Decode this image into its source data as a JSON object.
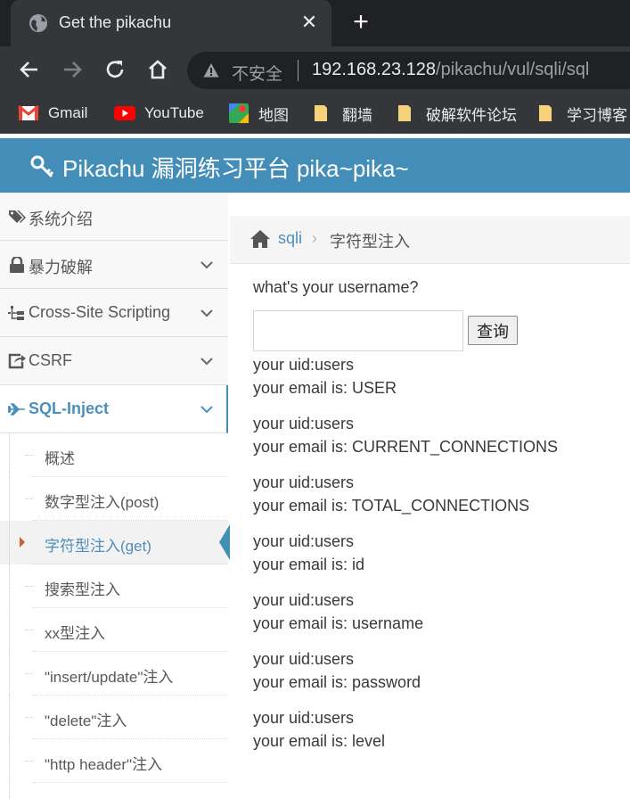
{
  "browser": {
    "tab_title": "Get the pikachu",
    "close_glyph": "✕",
    "new_tab_glyph": "+",
    "insecure_label": "不安全",
    "url_host": "192.168.23.128",
    "url_path": "/pikachu/vul/sqli/sql"
  },
  "bookmarks": [
    {
      "label": "Gmail",
      "icon": "gmail-icon"
    },
    {
      "label": "YouTube",
      "icon": "youtube-icon"
    },
    {
      "label": "地图",
      "icon": "maps-icon"
    },
    {
      "label": "翻墙",
      "icon": "folder-icon"
    },
    {
      "label": "破解软件论坛",
      "icon": "folder-icon"
    },
    {
      "label": "学习博客",
      "icon": "folder-icon"
    }
  ],
  "header": {
    "title": "Pikachu 漏洞练习平台 pika~pika~"
  },
  "sidebar": {
    "items": [
      {
        "label": "系统介绍",
        "icon": "tags-icon"
      },
      {
        "label": "暴力破解",
        "icon": "lock-icon"
      },
      {
        "label": "Cross-Site Scripting",
        "icon": "sitemap-icon"
      },
      {
        "label": "CSRF",
        "icon": "share-icon"
      },
      {
        "label": "SQL-Inject",
        "icon": "plane-icon"
      }
    ],
    "sub_items": [
      {
        "label": "概述"
      },
      {
        "label": "数字型注入(post)"
      },
      {
        "label": "字符型注入(get)"
      },
      {
        "label": "搜索型注入"
      },
      {
        "label": "xx型注入"
      },
      {
        "label": "\"insert/update\"注入"
      },
      {
        "label": "\"delete\"注入"
      },
      {
        "label": "\"http header\"注入"
      }
    ]
  },
  "breadcrumb": {
    "parent": "sqli",
    "separator": "›",
    "current": "字符型注入"
  },
  "form": {
    "question": "what's your username?",
    "input_value": "",
    "submit_label": "查询"
  },
  "results": [
    {
      "uid": "your uid:users",
      "email": "your email is: USER"
    },
    {
      "uid": "your uid:users",
      "email": "your email is: CURRENT_CONNECTIONS"
    },
    {
      "uid": "your uid:users",
      "email": "your email is: TOTAL_CONNECTIONS"
    },
    {
      "uid": "your uid:users",
      "email": "your email is: id"
    },
    {
      "uid": "your uid:users",
      "email": "your email is: username"
    },
    {
      "uid": "your uid:users",
      "email": "your email is: password"
    },
    {
      "uid": "your uid:users",
      "email": "your email is: level"
    }
  ],
  "colors": {
    "header_bg": "#438eb9",
    "link": "#4c8fbd",
    "active_caret": "#c86139"
  }
}
